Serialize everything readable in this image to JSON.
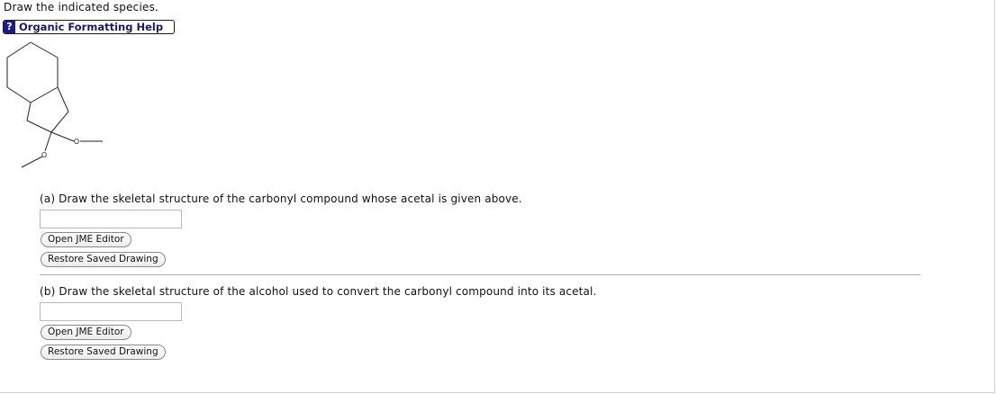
{
  "header": {
    "instruction": "Draw the indicated species.",
    "help_icon": "?",
    "help_label": "Organic Formatting Help"
  },
  "structure": {
    "atom_labels": [
      "O",
      "O"
    ]
  },
  "part_a": {
    "prompt": "(a) Draw the skeletal structure of the carbonyl compound whose acetal is given above.",
    "open_editor_label": "Open JME Editor",
    "restore_label": "Restore Saved Drawing"
  },
  "part_b": {
    "prompt": "(b) Draw the skeletal structure of the alcohol used to convert the carbonyl compound into its acetal.",
    "open_editor_label": "Open JME Editor",
    "restore_label": "Restore Saved Drawing"
  },
  "colors": {
    "help_icon_bg": "#1b1b8c",
    "divider": "#b0b0b0"
  }
}
